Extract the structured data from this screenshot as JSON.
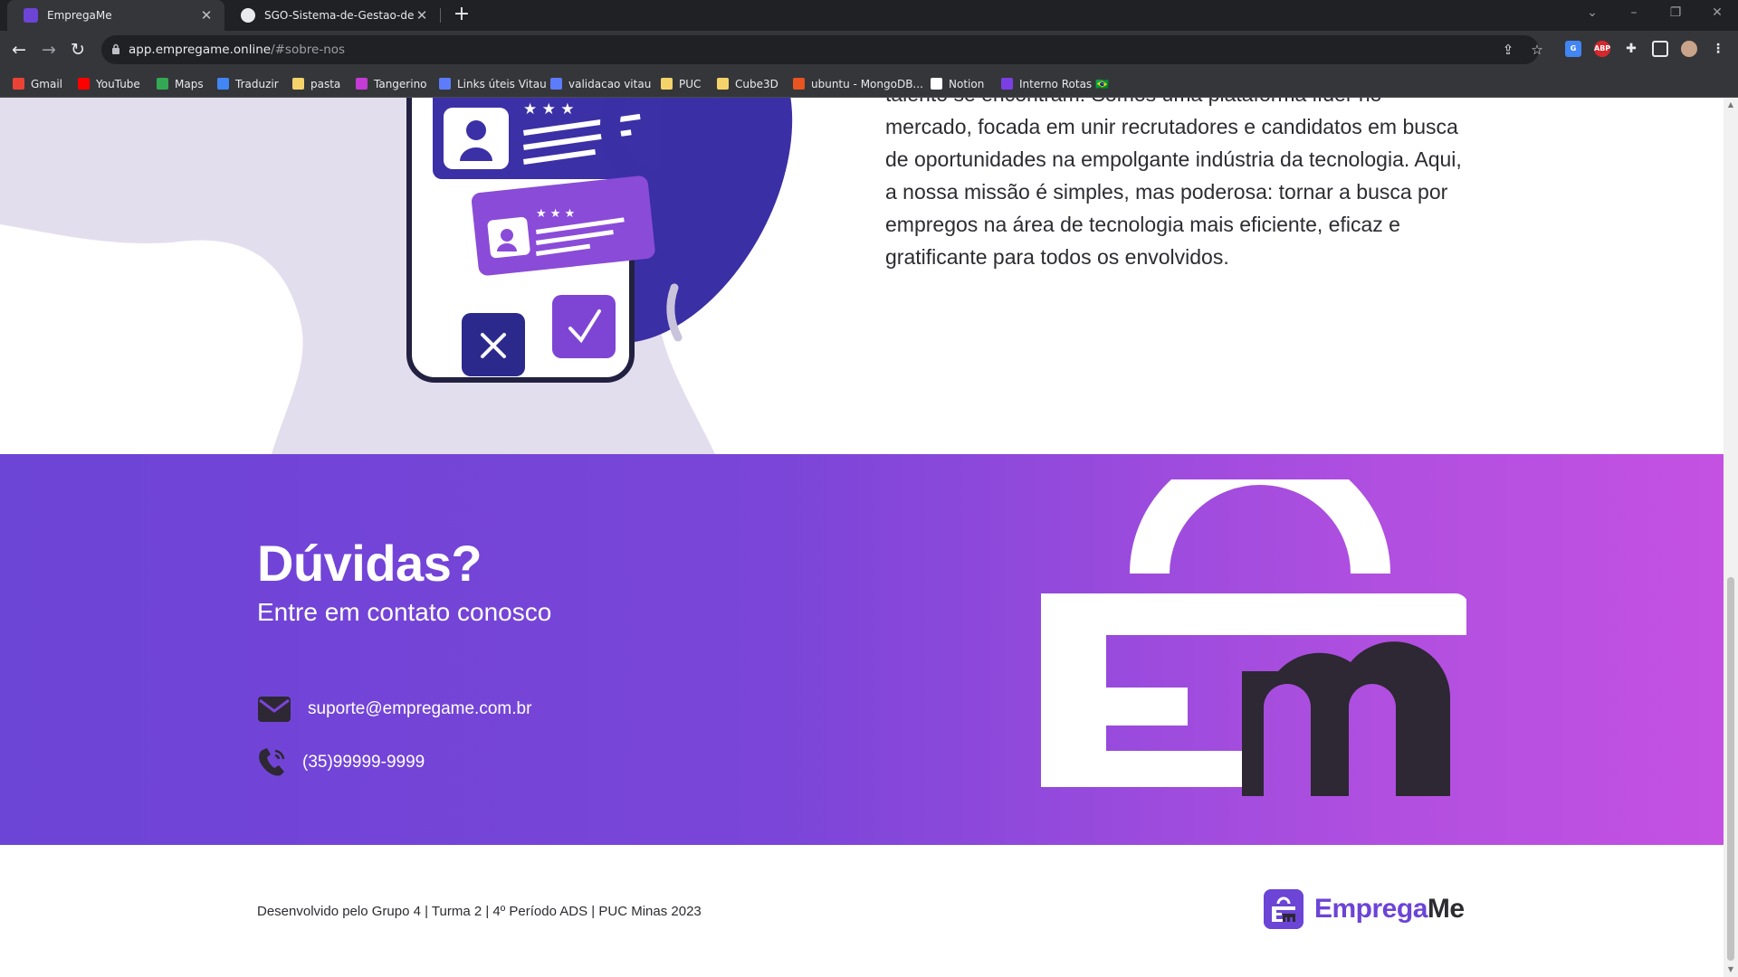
{
  "browser": {
    "tabs": [
      {
        "title": "EmpregaMe",
        "active": true
      },
      {
        "title": "SGO-Sistema-de-Gestao-de-ON",
        "active": false
      }
    ],
    "url_host": "app.empregame.online",
    "url_path": "/#sobre-nos",
    "bookmarks": [
      {
        "label": "Gmail",
        "icon": "gmail-icon",
        "color": "#ea4335"
      },
      {
        "label": "YouTube",
        "icon": "youtube-icon",
        "color": "#ff0000"
      },
      {
        "label": "Maps",
        "icon": "maps-icon",
        "color": "#34a853"
      },
      {
        "label": "Traduzir",
        "icon": "translate-icon",
        "color": "#4285f4"
      },
      {
        "label": "pasta",
        "icon": "folder-icon",
        "color": "#f4d36b"
      },
      {
        "label": "Tangerino",
        "icon": "tangerino-icon",
        "color": "#c43bd6"
      },
      {
        "label": "Links úteis Vitau",
        "icon": "vitau-icon",
        "color": "#5c7cfa"
      },
      {
        "label": "validacao vitau",
        "icon": "vitau-icon",
        "color": "#5c7cfa"
      },
      {
        "label": "PUC",
        "icon": "folder-icon",
        "color": "#f4d36b"
      },
      {
        "label": "Cube3D",
        "icon": "folder-icon",
        "color": "#f4d36b"
      },
      {
        "label": "ubuntu - MongoDB...",
        "icon": "ubuntu-icon",
        "color": "#e95420"
      },
      {
        "label": "Notion",
        "icon": "notion-icon",
        "color": "#ffffff"
      },
      {
        "label": "Interno Rotas 🇧🇷",
        "icon": "rotas-icon",
        "color": "#7b3fe4"
      }
    ]
  },
  "about": {
    "text": "talento se encontram! Somos uma plataforma líder no mercado, focada em unir recrutadores e candidatos em busca de oportunidades na empolgante indústria da tecnologia. Aqui, a nossa missão é simples, mas poderosa: tornar a busca por empregos na área de tecnologia mais eficiente, eficaz e gratificante para todos os envolvidos."
  },
  "contact": {
    "title": "Dúvidas?",
    "subtitle": "Entre em contato conosco",
    "email": "suporte@empregame.com.br",
    "phone": "(35)99999-9999"
  },
  "footer": {
    "credits": "Desenvolvido pelo Grupo 4 | Turma 2 | 4º Período ADS | PUC Minas 2023",
    "brand_part1": "Emprega",
    "brand_part2": "Me"
  },
  "colors": {
    "brand_purple": "#6c44d6",
    "gradient_end": "#c451e2",
    "text_dark": "#2c2c31"
  }
}
